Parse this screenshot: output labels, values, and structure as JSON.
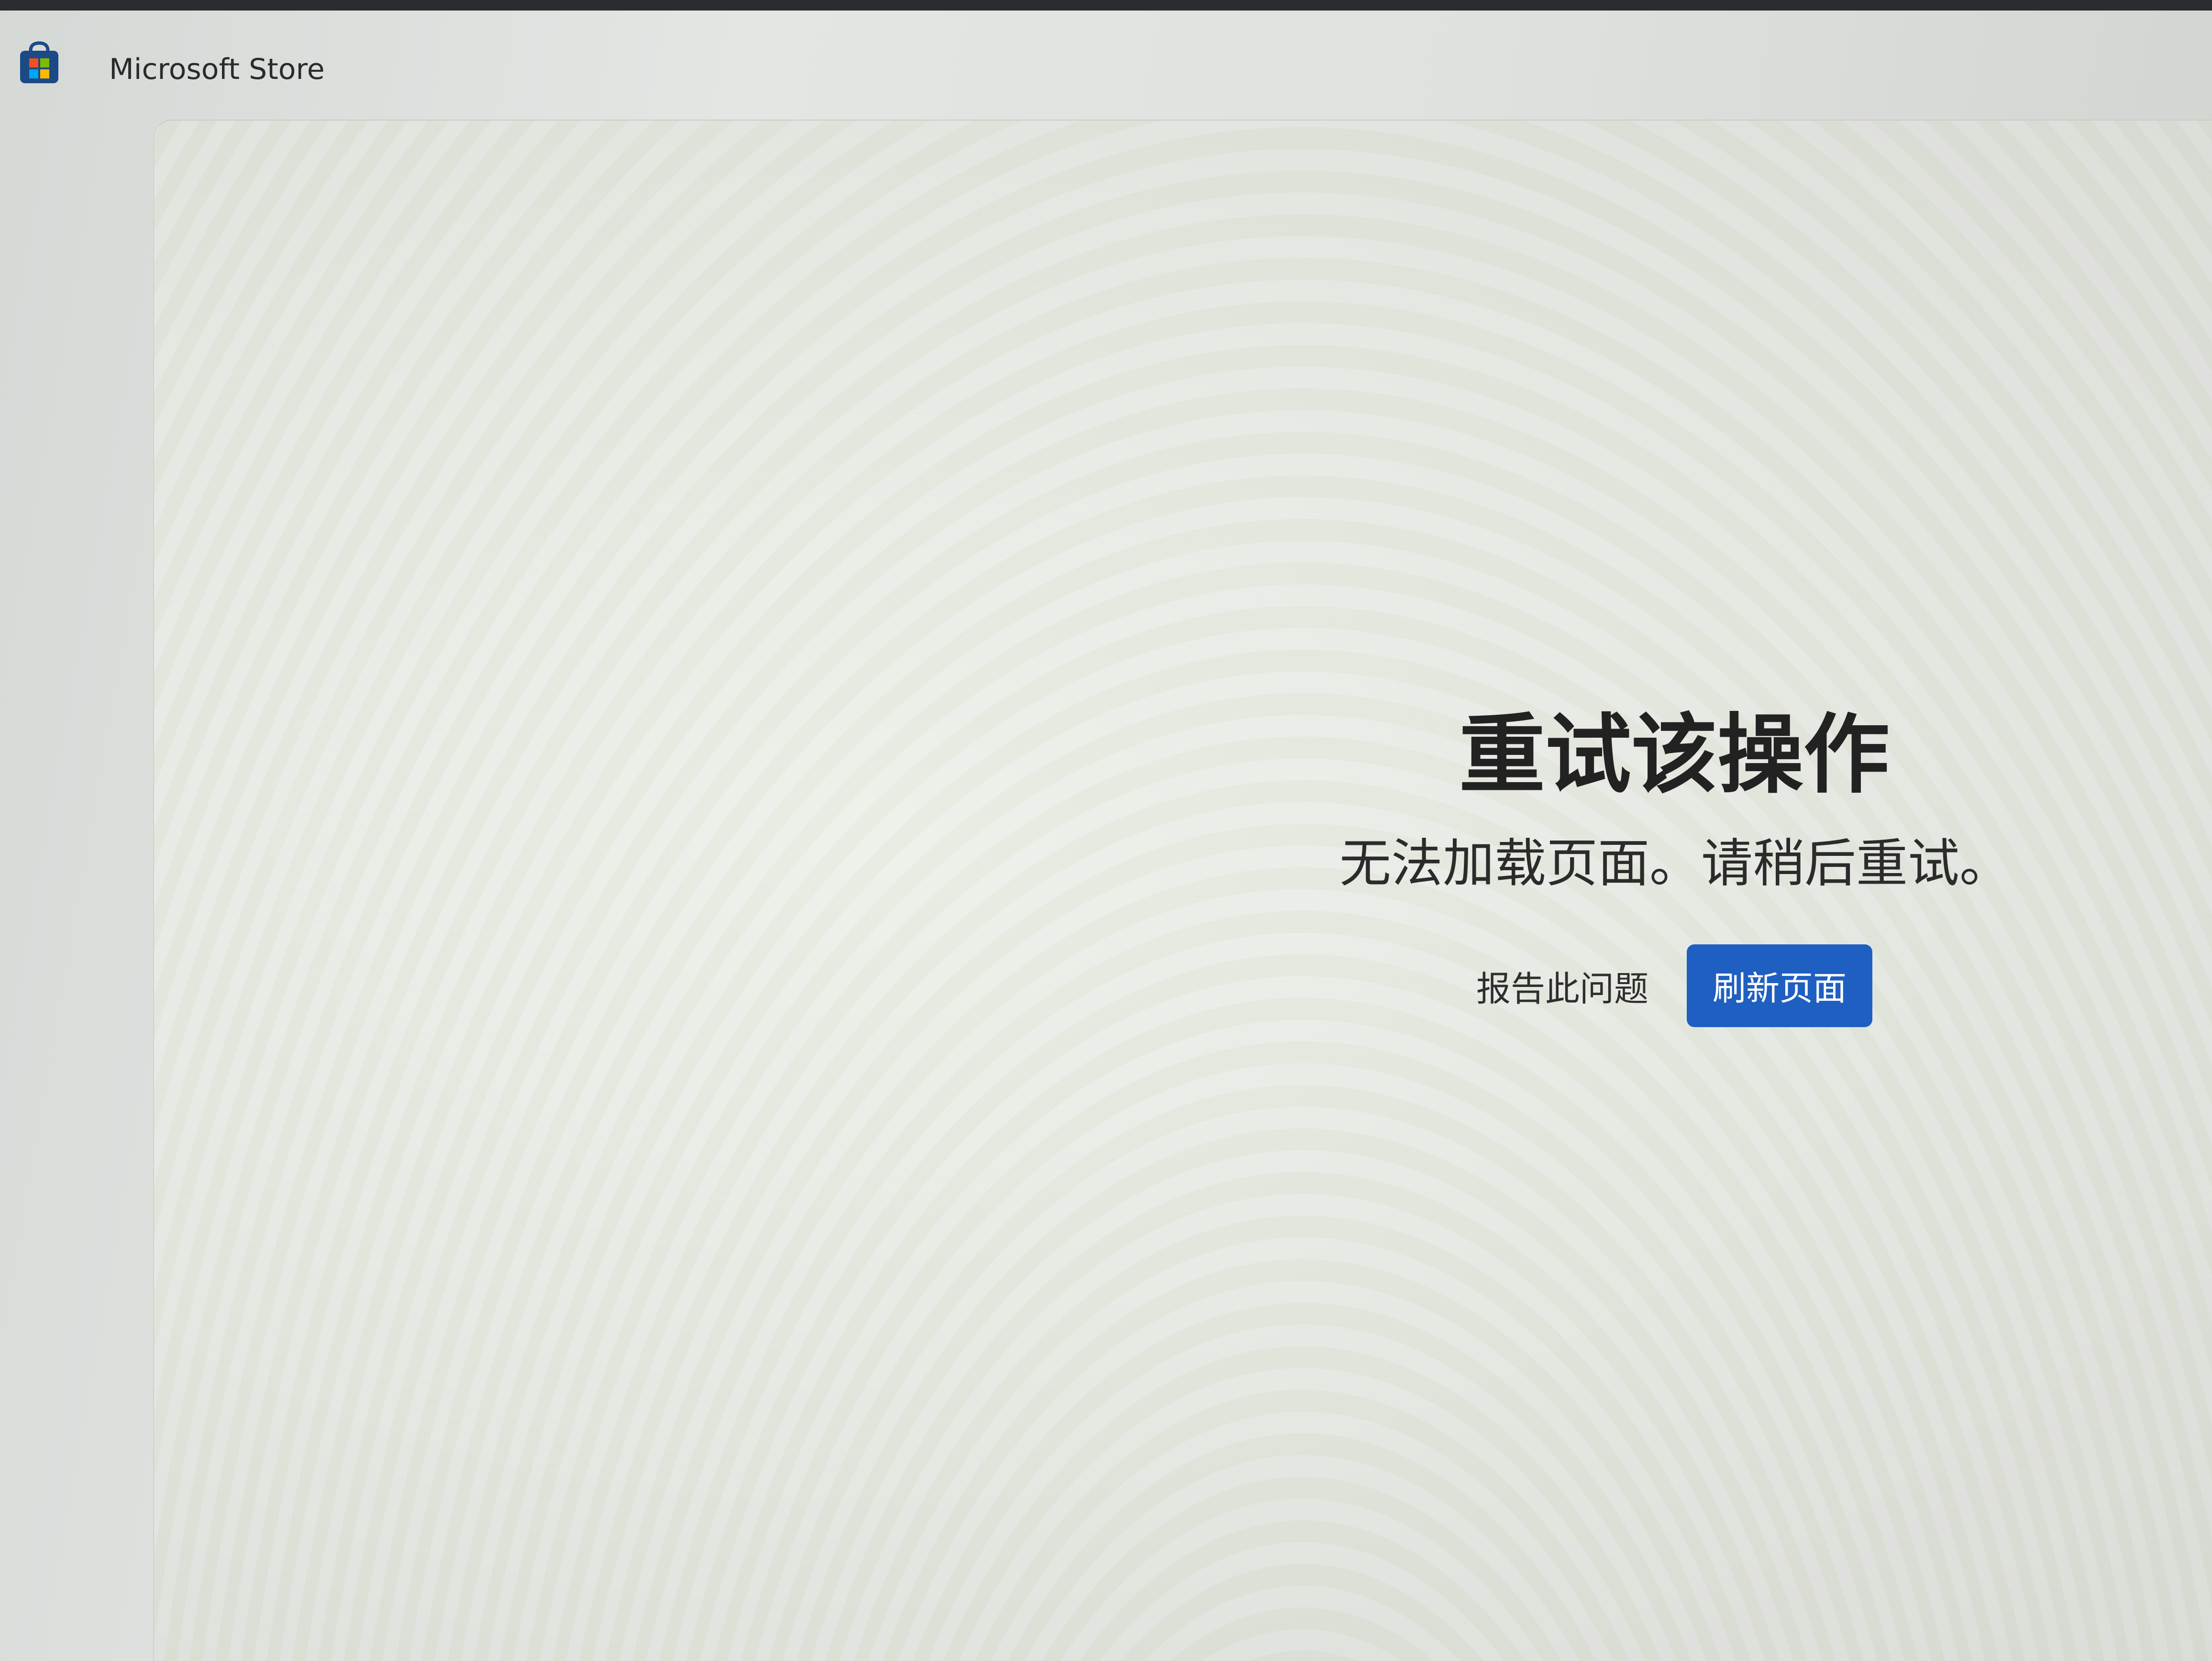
{
  "window": {
    "app_title": "Microsoft Store",
    "app_icon": "store-bag-icon"
  },
  "error": {
    "title": "重试该操作",
    "message": "无法加载页面。请稍后重试。",
    "report_label": "报告此问题",
    "refresh_label": "刷新页面"
  },
  "colors": {
    "accent": "#1f5fc2",
    "text": "#222222"
  }
}
